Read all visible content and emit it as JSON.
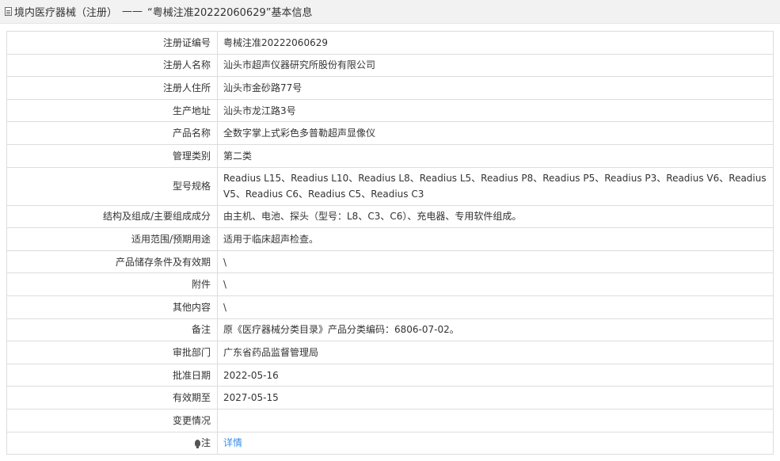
{
  "header": {
    "category": "境内医疗器械（注册）",
    "separator": "——",
    "title": "“粤械注准20222060629”基本信息"
  },
  "rows": [
    {
      "label": "注册证编号",
      "value": "粤械注准20222060629"
    },
    {
      "label": "注册人名称",
      "value": "汕头市超声仪器研究所股份有限公司"
    },
    {
      "label": "注册人住所",
      "value": "汕头市金砂路77号"
    },
    {
      "label": "生产地址",
      "value": "汕头市龙江路3号"
    },
    {
      "label": "产品名称",
      "value": "全数字掌上式彩色多普勒超声显像仪"
    },
    {
      "label": "管理类别",
      "value": "第二类"
    },
    {
      "label": "型号规格",
      "value": "Readius L15、Readius L10、Readius L8、Readius L5、Readius P8、Readius P5、Readius P3、Readius V6、Readius V5、Readius C6、Readius C5、Readius C3"
    },
    {
      "label": "结构及组成/主要组成成分",
      "value": "由主机、电池、探头（型号：L8、C3、C6）、充电器、专用软件组成。"
    },
    {
      "label": "适用范围/预期用途",
      "value": "适用于临床超声检查。"
    },
    {
      "label": "产品储存条件及有效期",
      "value": "\\"
    },
    {
      "label": "附件",
      "value": "\\"
    },
    {
      "label": "其他内容",
      "value": "\\"
    },
    {
      "label": "备注",
      "value": "原《医疗器械分类目录》产品分类编码：6806-07-02。"
    },
    {
      "label": "审批部门",
      "value": "广东省药品监督管理局"
    },
    {
      "label": "批准日期",
      "value": "2022-05-16"
    },
    {
      "label": "有效期至",
      "value": "2027-05-15"
    },
    {
      "label": "变更情况",
      "value": ""
    },
    {
      "label": "注",
      "value": "详情"
    }
  ],
  "colors": {
    "link": "#3a8ee6",
    "border": "#dddddd",
    "header_bg": "#f2f2f2"
  },
  "icons": {
    "header": "document-icon",
    "note": "lightbulb-icon"
  }
}
